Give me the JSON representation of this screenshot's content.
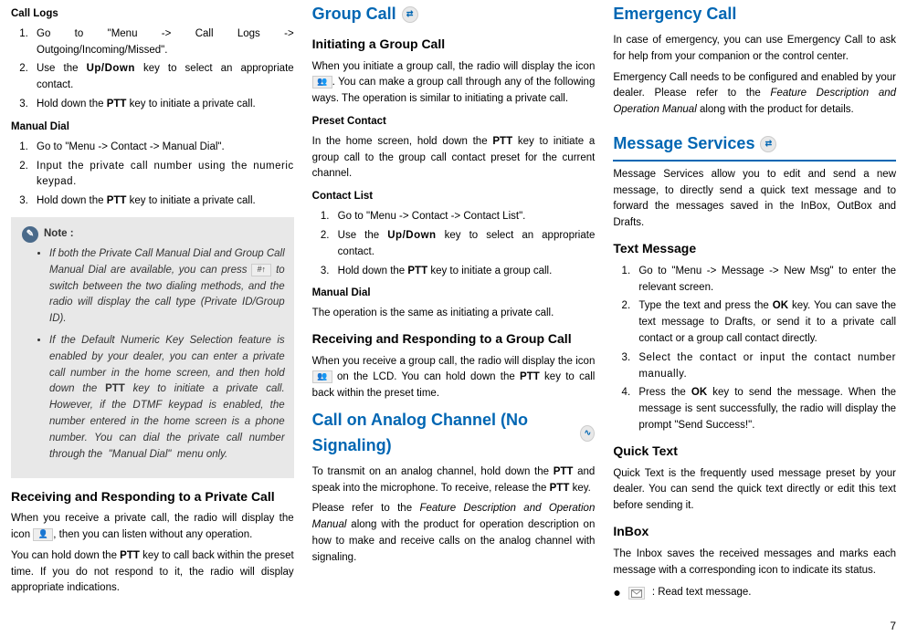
{
  "col1": {
    "callLogs": {
      "title": "Call Logs",
      "items": [
        "Go to \"Menu -> Call Logs -> Outgoing/Incoming/Missed\".",
        "Use the <span class='bold letterspace'>Up/Down</span> key to select an appropriate contact.",
        "Hold down the <span class='bold'>PTT</span> key to initiate a private call."
      ]
    },
    "manualDial": {
      "title": "Manual Dial",
      "items": [
        "Go to \"Menu -> Contact -> Manual Dial\".",
        "<span class='letterspace'>Input the private call number using the numeric keypad.</span>",
        "Hold down the <span class='bold'>PTT</span> key to initiate a private call."
      ]
    },
    "note": {
      "label": "Note :",
      "bullets": [
        "If both the Private Call Manual Dial and Group Call Manual Dial are available, you can press <span class='iconrect' data-name='hash-up-key-icon' data-interactable='false'>#↑</span> to switch between the two dialing methods, and the radio will display the call type (Private ID/Group ID).",
        "If the Default Numeric Key Selection feature is enabled by your dealer, you can enter a private call number in the home screen, and then hold down the <span class='bold' style='font-style:normal'>PTT</span> key to initiate a private call. However, if the DTMF keypad is enabled, the number entered in the home screen is a phone number. You can dial the private call number through the  \"Manual Dial\"  menu only."
      ]
    },
    "recv": {
      "title": "Receiving and Responding to a Private Call",
      "p1": "When you receive a private call, the radio will display the icon <span class='iconrect' data-name='private-call-icon' data-interactable='false'>👤</span>, then you can listen without any operation.",
      "p2": "You can hold down the <span class='bold'>PTT</span> key to call back within the preset time. If you do not respond to it, the radio will display appropriate indications."
    }
  },
  "col2": {
    "groupCall": {
      "title": "Group Call",
      "init": {
        "title": "Initiating a Group Call",
        "p": "When you initiate a group call, the radio will display the icon <span class='iconrect' data-name='group-call-icon' data-interactable='false'>👥</span>. You can make a group call through any of the following ways. The operation is similar to initiating a private call."
      },
      "preset": {
        "title": "Preset Contact",
        "p": "In the home screen, hold down the <span class='bold'>PTT</span> key to initiate a group call to the group call contact preset for the current channel."
      },
      "contactList": {
        "title": "Contact List",
        "items": [
          "Go to \"Menu -> Contact -> Contact List\".",
          "Use the <span class='bold letterspace'>Up/Down</span> key to select an appropriate contact.",
          "Hold down the <span class='bold'>PTT</span> key to initiate a group call."
        ]
      },
      "manualDial": {
        "title": "Manual Dial",
        "p": "The operation is the same as initiating a private call."
      },
      "recv": {
        "title": "Receiving and Responding to a Group Call",
        "p": "When you receive a group call, the radio will display the icon <span class='iconrect' data-name='group-call-incoming-icon' data-interactable='false'>👥</span> on the LCD. You can hold down the <span class='bold'>PTT</span> key to call back within the preset time."
      }
    },
    "analog": {
      "title": "Call on Analog Channel (No Signaling)",
      "p1": "To transmit on an analog channel, hold down the <span class='bold'>PTT</span> and speak into the microphone. To receive, release the <span class='bold'>PTT</span> key.",
      "p2": "Please refer to the <span class='italic'>Feature Description and Operation Manual</span> along with the product for operation description on how to make and receive calls on the analog channel with signaling."
    }
  },
  "col3": {
    "emergency": {
      "title": "Emergency Call",
      "p1": "In case of emergency, you can use Emergency Call to ask for help from your companion or the control center.",
      "p2": "Emergency Call needs to be configured and enabled by your dealer. Please refer to the <span class='italic'>Feature Description and Operation Manual</span> along with the product for details."
    },
    "message": {
      "title": "Message Services",
      "intro": "Message Services allow you to edit and send a new message, to directly send a quick text message and to forward the messages saved in the InBox, OutBox and Drafts.",
      "text": {
        "title": "Text Message",
        "items": [
          "Go to \"Menu -> Message -> New Msg\" to enter the relevant screen.",
          "Type the text and press the <span class='bold'>OK</span> key. You can save the text message to Drafts, or send it to a private call contact or a group call contact directly.",
          "<span class='letterspace'>Select the contact or input the contact number manually.</span>",
          "Press the <span class='bold'>OK</span> key to send the message. When the message is sent successfully, the radio will display the prompt \"Send Success!\"."
        ]
      },
      "quick": {
        "title": "Quick Text",
        "p": "Quick Text is the frequently used message preset by your dealer. You can send the quick text directly or edit this text before sending it."
      },
      "inbox": {
        "title": "InBox",
        "p": "The Inbox saves the received messages and marks each message with a corresponding icon to indicate its status.",
        "b1": ": Read text message."
      }
    }
  },
  "pageNumber": "7"
}
